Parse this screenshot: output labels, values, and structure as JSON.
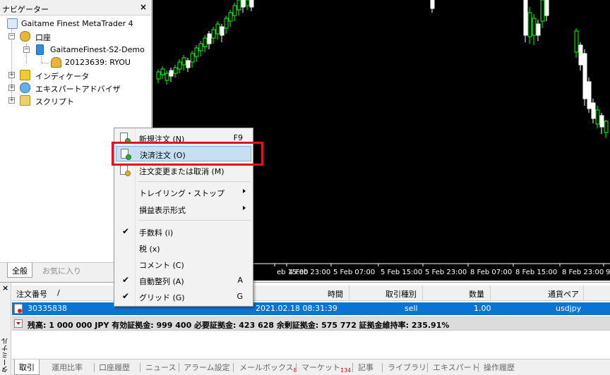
{
  "navigator": {
    "title": "ナビゲーター",
    "close": "×",
    "tree": {
      "root": "Gaitame Finest MetaTrader 4",
      "accounts": "口座",
      "server": "GaitameFinest-S2-Demo",
      "account": "20123639: RYOU",
      "indicators": "インディケータ",
      "experts": "エキスパートアドバイザ",
      "scripts": "スクリプト"
    },
    "tabs": [
      "全般",
      "お気に入り"
    ]
  },
  "chart": {
    "time_labels": [
      "eb 15:00",
      "4 Feb 23:00",
      "5 Feb 07:00",
      "5 Feb 15:00",
      "5 Feb 23:00",
      "8 Feb 07:00",
      "8 Feb 15:00",
      "8 Feb 23:00",
      "9"
    ],
    "colors": {
      "background": "#000000",
      "bull_candle": "#00ff00",
      "bear_candle": "#ffffff"
    }
  },
  "context_menu": {
    "items": [
      {
        "label": "新規注文 (N)",
        "shortcut": "F9"
      },
      {
        "label": "決済注文 (O)",
        "shortcut": ""
      },
      {
        "label": "注文変更または取消 (M)",
        "shortcut": ""
      },
      {
        "label": "トレイリング・ストップ",
        "shortcut": ""
      },
      {
        "label": "損益表示形式",
        "shortcut": ""
      },
      {
        "label": "手数料 (i)",
        "shortcut": "",
        "checked": true
      },
      {
        "label": "税 (x)",
        "shortcut": ""
      },
      {
        "label": "コメント (C)",
        "shortcut": ""
      },
      {
        "label": "自動整列 (A)",
        "shortcut": "A",
        "checked": true
      },
      {
        "label": "グリッド (G)",
        "shortcut": "G",
        "checked": true
      }
    ]
  },
  "terminal": {
    "side_label": "ターミナル",
    "close": "×",
    "columns": [
      "注文番号",
      "/",
      "時間",
      "取引種別",
      "数量",
      "通貨ペア"
    ],
    "order": {
      "ticket": "30335838",
      "time": "2021.02.18 08:31:39",
      "type": "sell",
      "volume": "1.00",
      "symbol": "usdjpy"
    },
    "balance_line": "残高: 1 000 000 JPY  有効証拠金: 999 400  必要証拠金: 423 628  余剰証拠金: 575 772  証拠金維持率: 235.91%",
    "tabs": [
      {
        "label": "取引"
      },
      {
        "label": "運用比率"
      },
      {
        "label": "口座履歴"
      },
      {
        "label": "ニュース"
      },
      {
        "label": "アラーム設定"
      },
      {
        "label": "メールボックス",
        "badge": "8"
      },
      {
        "label": "マーケット",
        "badge": "134"
      },
      {
        "label": "記事"
      },
      {
        "label": "ライブラリ"
      },
      {
        "label": "エキスパート"
      },
      {
        "label": "操作履歴"
      }
    ]
  },
  "highlight_color": "#e0141c"
}
